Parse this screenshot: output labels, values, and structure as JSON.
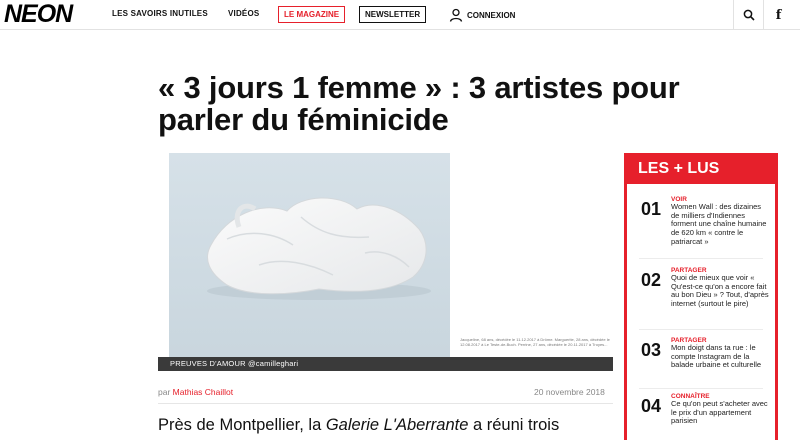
{
  "header": {
    "logo": "NEON",
    "nav": [
      "LES SAVOIRS INUTILES",
      "VIDÉOS"
    ],
    "magazine": "LE MAGAZINE",
    "newsletter": "NEWSLETTER",
    "connexion": "CONNEXION",
    "facebook_glyph": "f",
    "colors": {
      "accent": "#e6202b"
    }
  },
  "article": {
    "title": "« 3 jours 1 femme » : 3 artistes pour parler du féminicide",
    "photo_credit": "PREUVES D'AMOUR @camilleghari",
    "caption_tiny": "Jacqueline, 68 ans, décédée le 11.12.2017 à Drôme. Marguerite, 28 ans, décédée le 12.08.2017 à Le Teste-de-Buch. Perrine, 27 ans, décédée le 20.11.2017 à Troyes...",
    "byline_prefix": "par",
    "author": "Mathias Chaillot",
    "date": "20 novembre 2018",
    "body_start": "Près de Montpellier, la ",
    "body_italic": "Galerie L'Aberrante",
    "body_end": " a réuni trois"
  },
  "sidebar": {
    "title": "LES + LUS",
    "items": [
      {
        "num": "01",
        "category": "VOIR",
        "text": "Women Wall : des dizaines de milliers d'Indiennes forment une chaîne humaine de 620 km « contre le patriarcat »"
      },
      {
        "num": "02",
        "category": "PARTAGER",
        "text": "Quoi de mieux que voir « Qu'est-ce qu'on a encore fait au bon Dieu » ? Tout, d'après internet (surtout le pire)"
      },
      {
        "num": "03",
        "category": "PARTAGER",
        "text": "Mon doigt dans ta rue : le compte Instagram de la balade urbaine et culturelle"
      },
      {
        "num": "04",
        "category": "CONNAÎTRE",
        "text": "Ce qu'on peut s'acheter avec le prix d'un appartement parisien"
      }
    ]
  }
}
